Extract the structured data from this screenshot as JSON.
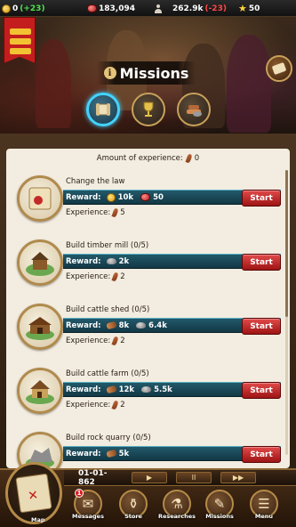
{
  "resources": {
    "gold": {
      "value": "0",
      "delta": "(+23)"
    },
    "rubies": {
      "value": "183,094"
    },
    "population": {
      "value": "262.9k",
      "delta": "(-23)"
    },
    "stars": {
      "value": "50"
    }
  },
  "header": {
    "title": "Missions"
  },
  "tabs": [
    {
      "name": "scroll",
      "active": true
    },
    {
      "name": "trophy",
      "active": false
    },
    {
      "name": "resources",
      "active": false
    }
  ],
  "experience_summary": {
    "label": "Amount of experience:",
    "value": "0"
  },
  "missions": [
    {
      "title": "Change the law",
      "reward_label": "Reward:",
      "rewards": [
        {
          "icon": "coin-icon",
          "amount": "10k"
        },
        {
          "icon": "ruby-icon",
          "amount": "50"
        }
      ],
      "experience_label": "Experience:",
      "experience": "5",
      "button": "Start"
    },
    {
      "title": "Build timber mill (0/5)",
      "reward_label": "Reward:",
      "rewards": [
        {
          "icon": "stone-icon",
          "amount": "2k"
        }
      ],
      "experience_label": "Experience:",
      "experience": "2",
      "button": "Start"
    },
    {
      "title": "Build cattle shed (0/5)",
      "reward_label": "Reward:",
      "rewards": [
        {
          "icon": "wood-icon",
          "amount": "8k"
        },
        {
          "icon": "stone-icon",
          "amount": "6.4k"
        }
      ],
      "experience_label": "Experience:",
      "experience": "2",
      "button": "Start"
    },
    {
      "title": "Build cattle farm (0/5)",
      "reward_label": "Reward:",
      "rewards": [
        {
          "icon": "wood-icon",
          "amount": "12k"
        },
        {
          "icon": "stone-icon",
          "amount": "5.5k"
        }
      ],
      "experience_label": "Experience:",
      "experience": "2",
      "button": "Start"
    },
    {
      "title": "Build rock quarry (0/5)",
      "reward_label": "Reward:",
      "rewards": [
        {
          "icon": "wood-icon",
          "amount": "5k"
        }
      ],
      "experience_label": "Experience:",
      "experience": "",
      "button": "Start"
    }
  ],
  "footer": {
    "date": "01-01-862",
    "speed_buttons": [
      "▶",
      "II",
      "▶▶"
    ],
    "nav": [
      {
        "label": "Map",
        "icon": "map-icon"
      },
      {
        "label": "Messages",
        "icon": "messages-icon",
        "badge": "1"
      },
      {
        "label": "Store",
        "icon": "store-icon"
      },
      {
        "label": "Researches",
        "icon": "researches-icon"
      },
      {
        "label": "Missions",
        "icon": "missions-icon"
      },
      {
        "label": "Menu",
        "icon": "menu-icon"
      }
    ]
  },
  "colors": {
    "accent_blue": "#43d3ff",
    "start_red": "#c42a2a",
    "reward_teal": "#1d4e5e",
    "panel": "#f3ece0"
  }
}
